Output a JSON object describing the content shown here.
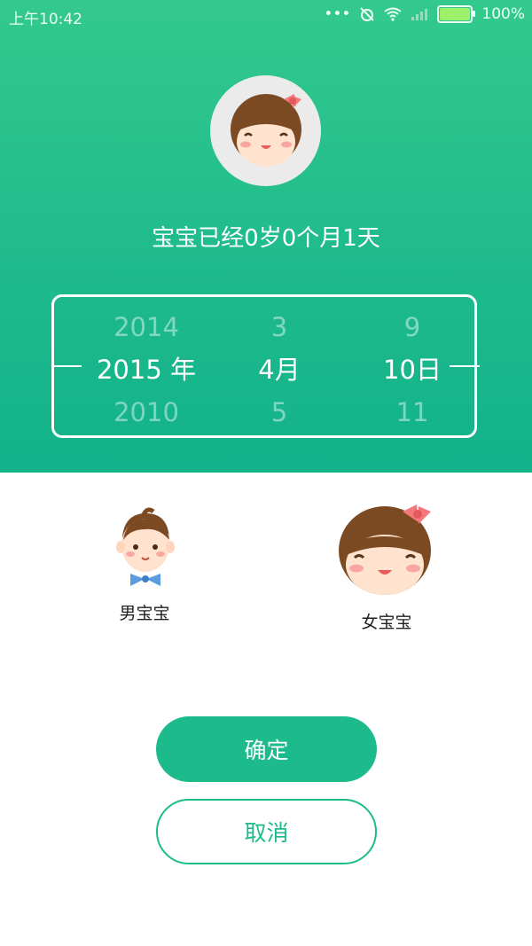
{
  "status_bar": {
    "time": "上午10:42",
    "battery_percent": "100%",
    "icons": [
      "more-dots-icon",
      "alarm-off-icon",
      "wifi-icon",
      "signal-icon",
      "battery-icon"
    ]
  },
  "profile": {
    "age_text": "宝宝已经0岁0个月1天"
  },
  "picker": {
    "year": {
      "above": "2014",
      "selected": "2015 年",
      "below": "2010"
    },
    "month": {
      "above": "3",
      "selected": "4月",
      "below": "5"
    },
    "day": {
      "above": "9",
      "selected": "10日",
      "below": "11"
    }
  },
  "gender": {
    "boy_label": "男宝宝",
    "girl_label": "女宝宝"
  },
  "actions": {
    "confirm": "确定",
    "cancel": "取消"
  },
  "colors": {
    "accent": "#1dbb8c",
    "header_top": "#33c98e",
    "header_bottom": "#13b28a"
  }
}
